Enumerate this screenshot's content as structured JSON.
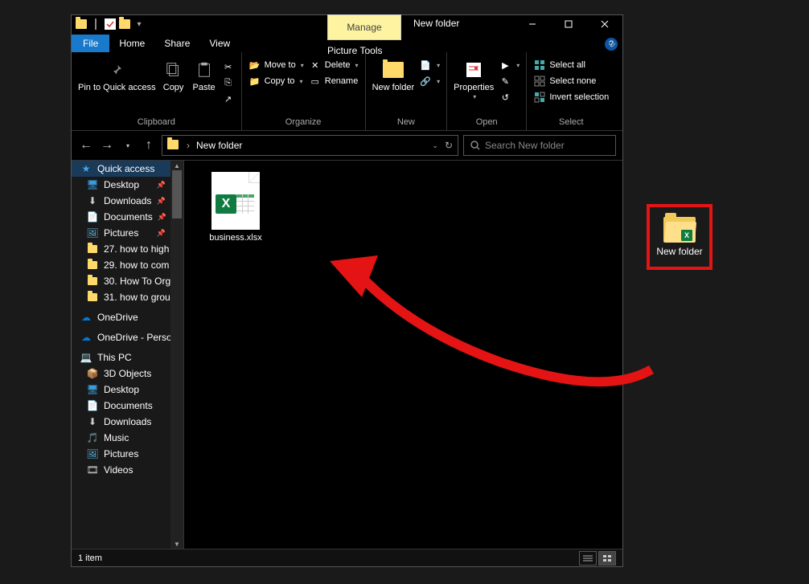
{
  "window": {
    "title": "New folder",
    "manage_tab": "Manage",
    "picture_tools": "Picture Tools",
    "tabs": {
      "file": "File",
      "home": "Home",
      "share": "Share",
      "view": "View"
    }
  },
  "ribbon": {
    "clipboard": {
      "label": "Clipboard",
      "pin": "Pin to Quick access",
      "copy": "Copy",
      "paste": "Paste"
    },
    "organize": {
      "label": "Organize",
      "move_to": "Move to",
      "copy_to": "Copy to",
      "delete": "Delete",
      "rename": "Rename"
    },
    "new": {
      "label": "New",
      "new_folder": "New folder"
    },
    "open": {
      "label": "Open",
      "properties": "Properties"
    },
    "select": {
      "label": "Select",
      "select_all": "Select all",
      "select_none": "Select none",
      "invert": "Invert selection"
    }
  },
  "address": {
    "path": "New folder",
    "search_placeholder": "Search New folder"
  },
  "sidebar": {
    "quick_access": "Quick access",
    "items": [
      {
        "label": "Desktop",
        "pin": true
      },
      {
        "label": "Downloads",
        "pin": true
      },
      {
        "label": "Documents",
        "pin": true
      },
      {
        "label": "Pictures",
        "pin": true
      },
      {
        "label": "27. how to high"
      },
      {
        "label": "29. how to com"
      },
      {
        "label": "30. How To Org"
      },
      {
        "label": "31. how to grou"
      }
    ],
    "onedrive": "OneDrive",
    "onedrive_personal": "OneDrive - Perso",
    "this_pc": "This PC",
    "pc_items": [
      {
        "label": "3D Objects"
      },
      {
        "label": "Desktop"
      },
      {
        "label": "Documents"
      },
      {
        "label": "Downloads"
      },
      {
        "label": "Music"
      },
      {
        "label": "Pictures"
      },
      {
        "label": "Videos"
      }
    ]
  },
  "content": {
    "file_name": "business.xlsx"
  },
  "status": {
    "item_count": "1 item"
  },
  "desktop_folder": {
    "label": "New folder"
  }
}
